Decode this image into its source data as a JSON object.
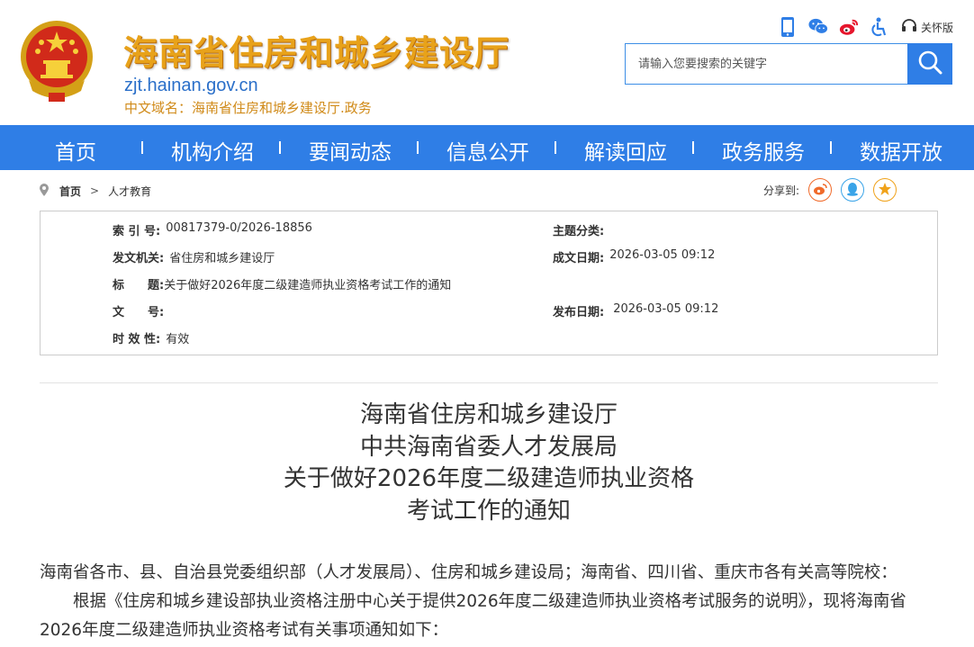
{
  "header": {
    "site_title": "海南省住房和城乡建设厅",
    "domain": "zjt.hainan.gov.cn",
    "cn_domain": "中文域名：海南省住房和城乡建设厅.政务",
    "care_mode_label": "关怀版",
    "icons": [
      "mobile-icon",
      "wechat-icon",
      "weibo-icon",
      "accessibility-icon",
      "care-mode-icon"
    ]
  },
  "search": {
    "placeholder": "请输入您要搜索的关键字"
  },
  "nav": {
    "items": [
      "首页",
      "机构介绍",
      "要闻动态",
      "信息公开",
      "解读回应",
      "政务服务",
      "数据开放"
    ]
  },
  "breadcrumb": {
    "home": "首页",
    "arrow": ">",
    "current": "人才教育"
  },
  "share": {
    "label": "分享到:"
  },
  "info": {
    "index_label": "索 引 号:",
    "index_value": "00817379-0/2026-18856",
    "category_label": "主题分类:",
    "category_value": "",
    "issuer_label": "发文机关:",
    "issuer_value": "省住房和城乡建设厅",
    "created_label": "成文日期:",
    "created_value": "2026-03-05 09:12",
    "title_label": "标　　题:",
    "title_value": "关于做好2026年度二级建造师执业资格考试工作的通知",
    "docno_label": "文　　号:",
    "docno_value": "",
    "published_label": "发布日期:",
    "published_value": "2026-03-05 09:12",
    "validity_label": "时 效 性:",
    "validity_value": "有效"
  },
  "article": {
    "title_lines": [
      "海南省住房和城乡建设厅",
      "中共海南省委人才发展局",
      "关于做好2026年度二级建造师执业资格",
      "考试工作的通知"
    ],
    "para1": "海南省各市、县、自治县党委组织部（人才发展局）、住房和城乡建设局；海南省、四川省、重庆市各有关高等院校：",
    "para2a": "　　根据《住房和城乡建设部执业资格注册中心关于提供2026年度二级建造师执业资格考试服务的说明》，现将海南省",
    "para2b": "2026年度二级建造师执业资格考试有关事项通知如下："
  },
  "colors": {
    "brand_blue": "#2f7ee6",
    "title_gold": "#e8a21a",
    "domain_blue": "#2a6fc9"
  }
}
